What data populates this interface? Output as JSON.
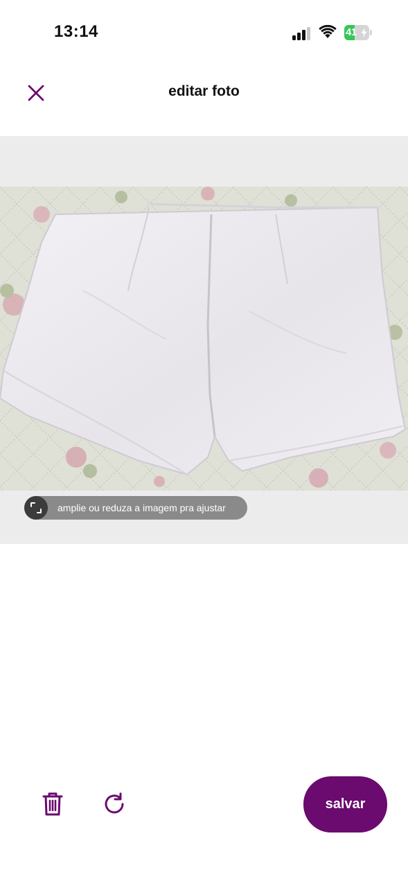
{
  "status_bar": {
    "time": "13:14",
    "battery_level": "41",
    "battery_percent": 41,
    "icons": [
      "cellular-signal-icon",
      "wifi-icon",
      "battery-charging-icon"
    ]
  },
  "header": {
    "title": "editar foto",
    "close_icon": "close-icon"
  },
  "editor": {
    "image_description_icon": "photo-of-white-shorts",
    "hint_text": "amplie ou reduza a imagem pra ajustar",
    "hint_icon": "resize-icon"
  },
  "toolbar": {
    "delete_icon": "trash-icon",
    "rotate_icon": "rotate-icon",
    "save_label": "salvar"
  },
  "colors": {
    "accent": "#6b0a6f",
    "editor_background": "#ececec",
    "hint_pill": "#8a8a8a",
    "battery_green": "#35c759"
  }
}
